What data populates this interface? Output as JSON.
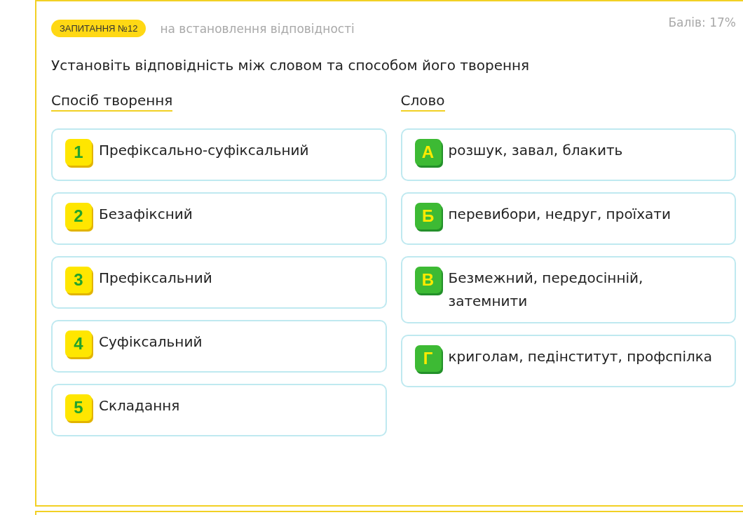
{
  "question": {
    "badge": "ЗАПИТАННЯ №12",
    "type_label": "на встановлення відповідності",
    "score": "Балів: 17%",
    "prompt": "Установіть відповідність між словом та способом його творення"
  },
  "columns": [
    {
      "kind": "number",
      "heading": "Спосіб творення",
      "items": [
        {
          "marker": "1",
          "text": "Префіксально-суфіксальний"
        },
        {
          "marker": "2",
          "text": "Безафіксний"
        },
        {
          "marker": "3",
          "text": "Префіксальний"
        },
        {
          "marker": "4",
          "text": "Суфіксальний"
        },
        {
          "marker": "5",
          "text": "Складання"
        }
      ]
    },
    {
      "kind": "letter",
      "heading": "Слово",
      "items": [
        {
          "marker": "А",
          "text": "розшук, завал, блакить"
        },
        {
          "marker": "Б",
          "text": "перевибори, недруг, проїхати"
        },
        {
          "marker": "В",
          "text": "Безмежний, передосінній, затемнити"
        },
        {
          "marker": "Г",
          "text": "криголам, педінститут, профспілка"
        }
      ]
    }
  ]
}
